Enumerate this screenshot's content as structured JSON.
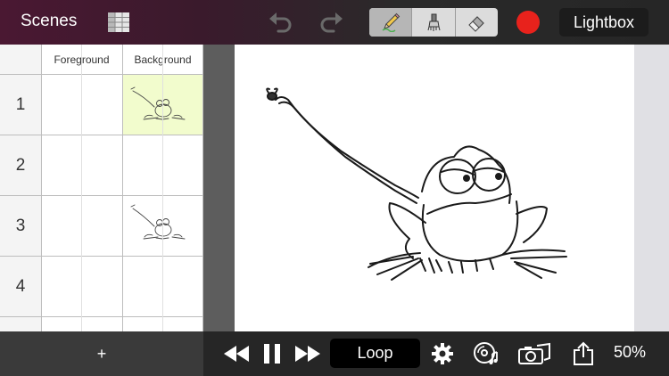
{
  "toolbar": {
    "scenes_label": "Scenes",
    "lightbox_label": "Lightbox",
    "tools": [
      {
        "name": "pencil-icon",
        "active": true
      },
      {
        "name": "brush-icon",
        "active": false
      },
      {
        "name": "eraser-icon",
        "active": false
      }
    ],
    "record_color": "#e8221c"
  },
  "sheet": {
    "columns": [
      "Foreground",
      "Background"
    ],
    "rows": [
      "1",
      "2",
      "3",
      "4"
    ],
    "highlight_color": "#f2fccd"
  },
  "playback": {
    "add_label": "+",
    "loop_label": "Loop",
    "zoom": "50%"
  }
}
